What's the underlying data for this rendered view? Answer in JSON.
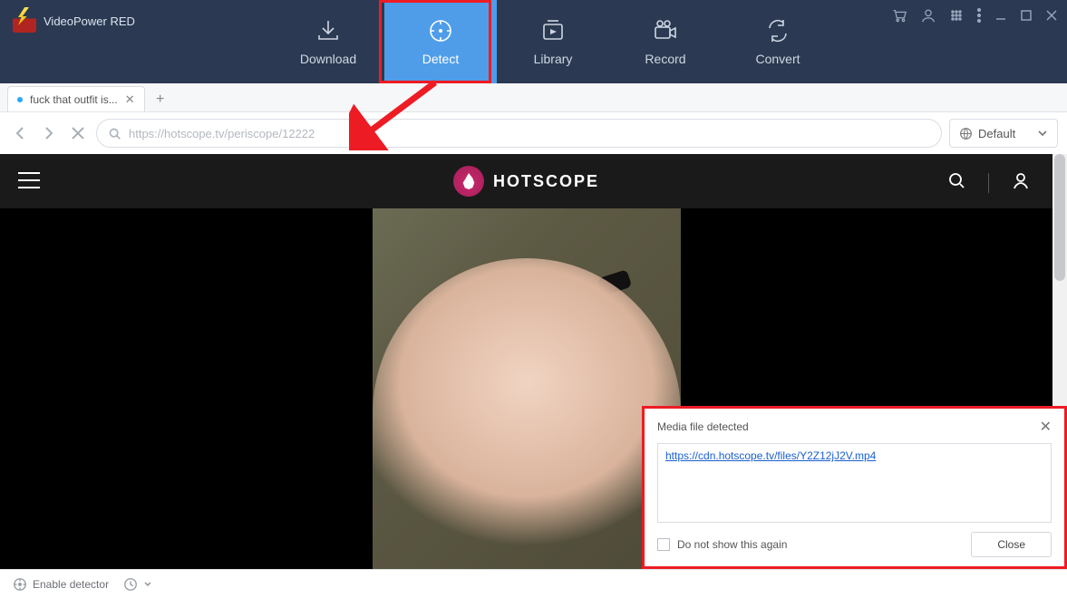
{
  "app": {
    "title": "VideoPower RED"
  },
  "toolbar": {
    "download": "Download",
    "detect": "Detect",
    "library": "Library",
    "record": "Record",
    "convert": "Convert"
  },
  "tab": {
    "title": "fuck that outfit is..."
  },
  "address": {
    "url": "https://hotscope.tv/periscope/12222"
  },
  "protocol": {
    "label": "Default"
  },
  "site": {
    "brand": "HOTSCOPE"
  },
  "popup": {
    "title": "Media file detected",
    "link": "https://cdn.hotscope.tv/files/Y2Z12jJ2V.mp4",
    "checkbox": "Do not show this again",
    "close": "Close"
  },
  "status": {
    "detector": "Enable detector"
  }
}
